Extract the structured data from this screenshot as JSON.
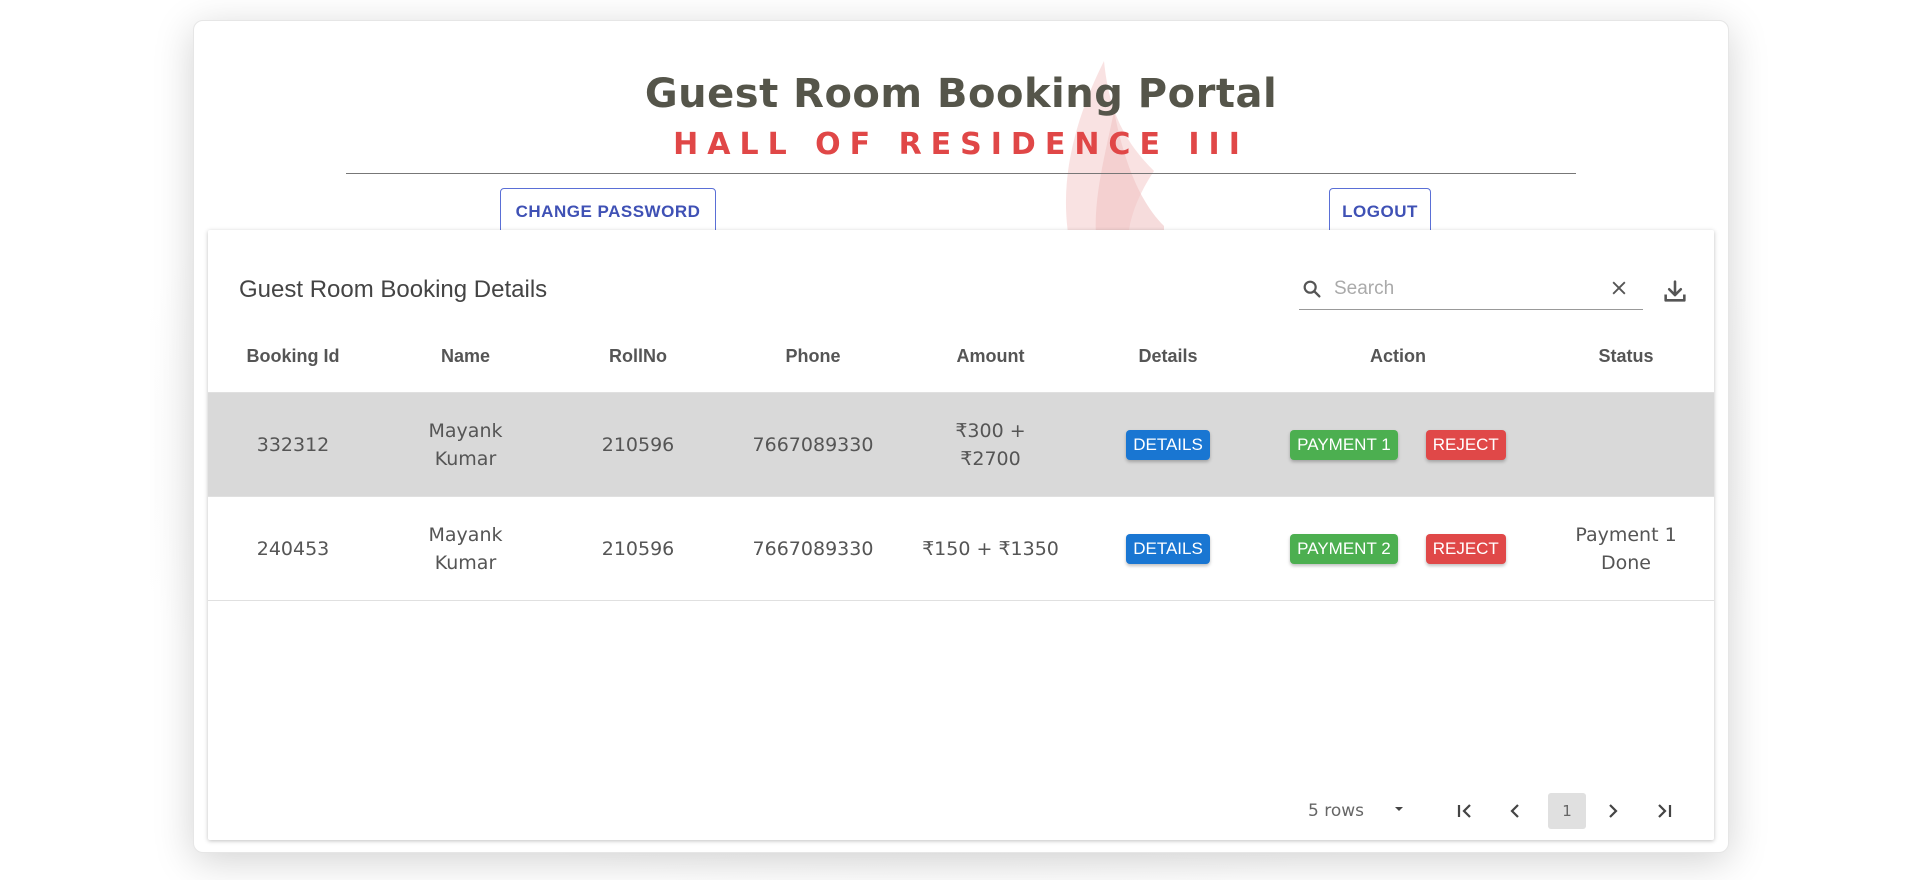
{
  "header": {
    "title": "Guest Room Booking Portal",
    "subtitle": "HALL OF RESIDENCE III"
  },
  "buttons": {
    "change_password": "CHANGE PASSWORD",
    "logout": "LOGOUT"
  },
  "panel": {
    "title": "Guest Room Booking Details",
    "search_placeholder": "Search"
  },
  "table": {
    "columns": [
      "Booking Id",
      "Name",
      "RollNo",
      "Phone",
      "Amount",
      "Details",
      "Action",
      "Status"
    ],
    "rows": [
      {
        "booking_id": "332312",
        "name_line1": "Mayank",
        "name_line2": "Kumar",
        "roll_no": "210596",
        "phone": "7667089330",
        "amount_line1": "₹300 +",
        "amount_line2": "₹2700",
        "details_label": "DETAILS",
        "payment_label": "PAYMENT 1",
        "reject_label": "REJECT",
        "status_line1": "",
        "status_line2": ""
      },
      {
        "booking_id": "240453",
        "name_line1": "Mayank",
        "name_line2": "Kumar",
        "roll_no": "210596",
        "phone": "7667089330",
        "amount_line1": "₹150 + ₹1350",
        "amount_line2": "",
        "details_label": "DETAILS",
        "payment_label": "PAYMENT 2",
        "reject_label": "REJECT",
        "status_line1": "Payment 1",
        "status_line2": "Done"
      }
    ]
  },
  "pagination": {
    "rows_per_page": "5 rows",
    "current_page": "1"
  },
  "colors": {
    "accent": "#3f51b5",
    "subtitle_red": "#e04747",
    "details_blue": "#1976d2",
    "payment_green": "#4caf50",
    "reject_red": "#e04848"
  }
}
